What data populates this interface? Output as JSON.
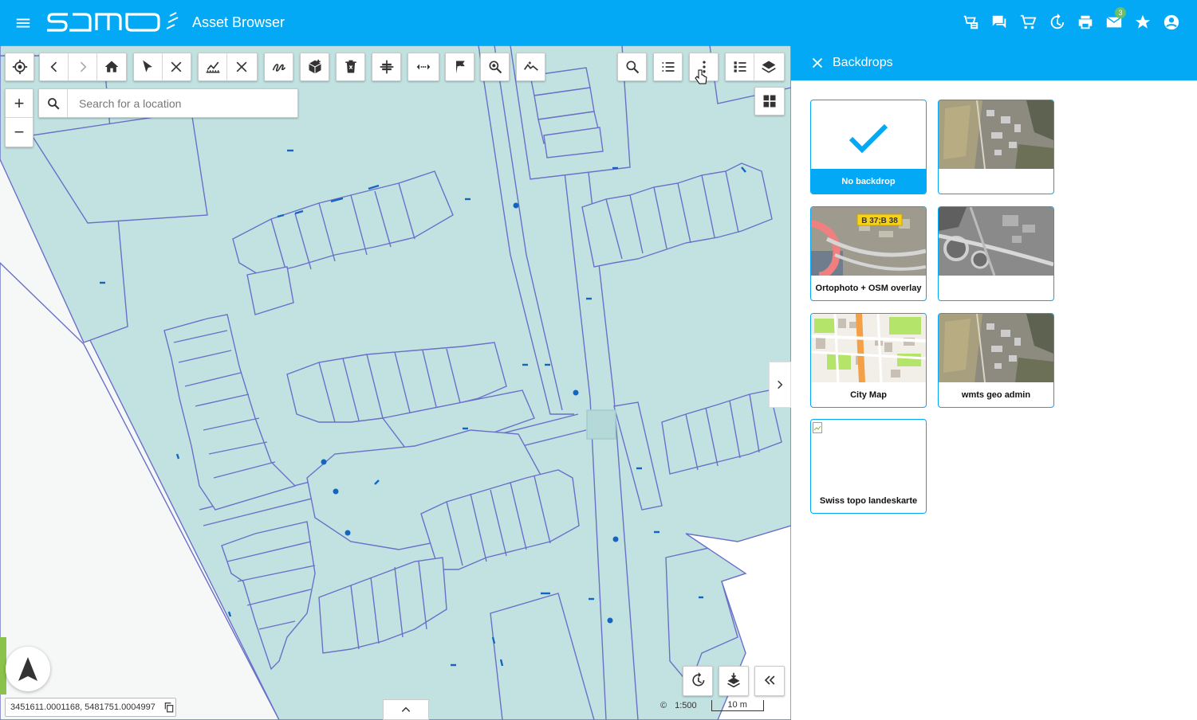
{
  "header": {
    "logo_text": "samo",
    "title": "Asset Browser",
    "icons": [
      "cart-list-icon",
      "chat-icon",
      "shopping-cart-icon",
      "history-icon",
      "print-icon",
      "mail-icon",
      "star-icon",
      "account-icon"
    ],
    "mail_badge": "3"
  },
  "search": {
    "placeholder": "Search for a location"
  },
  "toolbar": {
    "tools": [
      "locate-icon",
      "back-icon",
      "forward-icon",
      "home-icon",
      "select-arrow-icon",
      "clear-selection-icon",
      "measure-icon",
      "clear-measure-icon",
      "draw-freehand-icon",
      "add-object-icon",
      "delete-object-icon",
      "split-icon",
      "distance-icon",
      "flag-icon",
      "zoom-search-icon",
      "profile-icon",
      "search-icon",
      "list-icon",
      "more-vert-icon",
      "legend-icon",
      "layers-icon"
    ]
  },
  "coordinates": "3451611.0001168, 5481751.0004997",
  "scale": {
    "ratio": "1:500",
    "bar_label": "10 m"
  },
  "panel": {
    "title": "Backdrops",
    "backdrops": [
      {
        "label": "No backdrop",
        "selected": true
      },
      {
        "label": "",
        "selected": false
      },
      {
        "label": "Ortophoto + OSM overlay",
        "selected": false
      },
      {
        "label": "",
        "selected": false
      },
      {
        "label": "City Map",
        "selected": false
      },
      {
        "label": "wmts geo admin",
        "selected": false
      },
      {
        "label": "Swiss topo landeskarte",
        "selected": false
      }
    ],
    "osm_sign_text": "B 37;B 38"
  },
  "colors": {
    "brand": "#03a9f4",
    "parcel_fill": "#c2e2e2",
    "parcel_stroke": "#6a70c8",
    "feature_blue": "#1565c0"
  }
}
